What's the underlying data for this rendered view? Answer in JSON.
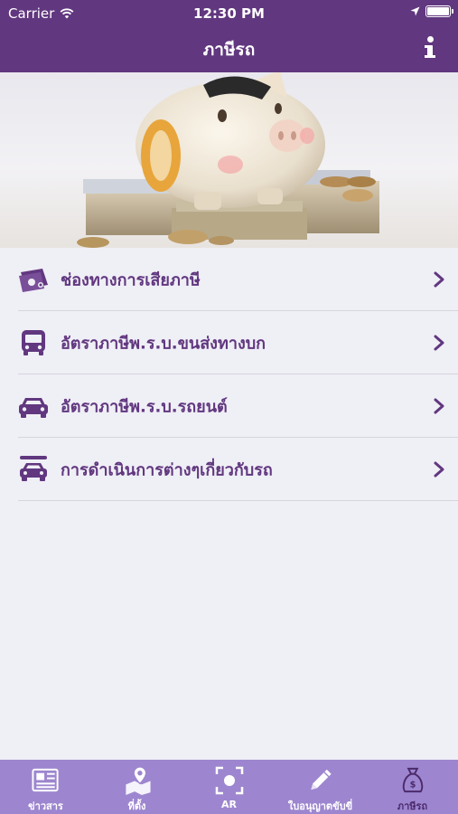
{
  "status_bar": {
    "carrier": "Carrier",
    "time": "12:30 PM"
  },
  "nav": {
    "title": "ภาษีรถ",
    "info_icon": "info-icon"
  },
  "hero": {
    "image": "piggy-bank-with-money-photo"
  },
  "menu": {
    "items": [
      {
        "label": "ช่องทางการเสียภาษี",
        "icon": "money-bill-icon"
      },
      {
        "label": "อัตราภาษีพ.ร.บ.ขนส่งทางบก",
        "icon": "bus-icon"
      },
      {
        "label": "อัตราภาษีพ.ร.บ.รถยนต์",
        "icon": "car-icon"
      },
      {
        "label": "การดำเนินการต่างๆเกี่ยวกับรถ",
        "icon": "car-service-icon"
      }
    ]
  },
  "tabs": [
    {
      "label": "ข่าวสาร",
      "icon": "newspaper-icon",
      "active": false
    },
    {
      "label": "ที่ตั้ง",
      "icon": "map-pin-icon",
      "active": false
    },
    {
      "label": "AR",
      "icon": "ar-scan-icon",
      "active": false
    },
    {
      "label": "ใบอนุญาตขับขี่",
      "icon": "pencil-icon",
      "active": false
    },
    {
      "label": "ภาษีรถ",
      "icon": "money-bag-icon",
      "active": true
    }
  ],
  "colors": {
    "primary": "#61377f",
    "tabbar": "#9d86cf",
    "background": "#efeff6"
  }
}
